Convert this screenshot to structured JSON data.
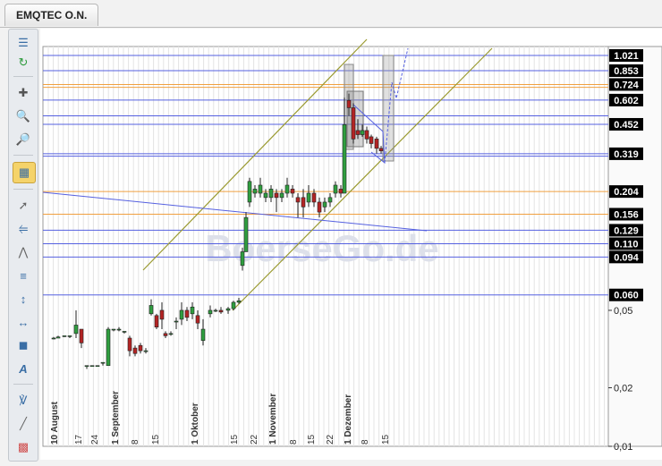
{
  "tab": {
    "label": "EMQTEC O.N."
  },
  "watermark": "BoerseGo.de",
  "toolbar": {
    "items": [
      "grip-icon",
      "refresh-icon",
      "crosshair-icon",
      "zoom-in-icon",
      "zoom-out-icon",
      "chart-settings-icon",
      "trendline-icon",
      "ruler-icon",
      "polyline-icon",
      "fibonacci-icon",
      "vertical-line-icon",
      "horizontal-line-icon",
      "rectangle-icon",
      "text-icon",
      "pitchfork-icon",
      "line-icon",
      "color-palette-icon"
    ]
  },
  "chart_data": {
    "type": "candlestick",
    "yscale": "log",
    "ylim": [
      0.01,
      1.1
    ],
    "price_tags": [
      "1.021",
      "0.853",
      "0.724",
      "0.602",
      "0.452",
      "0.319",
      "0.204",
      "0.156",
      "0.129",
      "0.110",
      "0.094",
      "0.060"
    ],
    "price_levels": [
      1.021,
      0.853,
      0.724,
      0.602,
      0.452,
      0.319,
      0.204,
      0.156,
      0.129,
      0.11,
      0.094,
      0.06
    ],
    "axis_ticks": [
      "0,05",
      "0,02",
      "0,01"
    ],
    "axis_tick_values": [
      0.05,
      0.02,
      0.01
    ],
    "x_labels": [
      "10 August",
      "17",
      "24",
      "1 September",
      "8",
      "15",
      "1 Oktober",
      "15",
      "22",
      "1 November",
      "8",
      "15",
      "22",
      "1 Dezember",
      "8",
      "15"
    ],
    "colors": {
      "up": "#2f9e3f",
      "down": "#b32424",
      "blue_line": "#5560e0",
      "orange_line": "#f0a040",
      "channel": "#9a9a30",
      "tag_bg": "#000000"
    }
  }
}
